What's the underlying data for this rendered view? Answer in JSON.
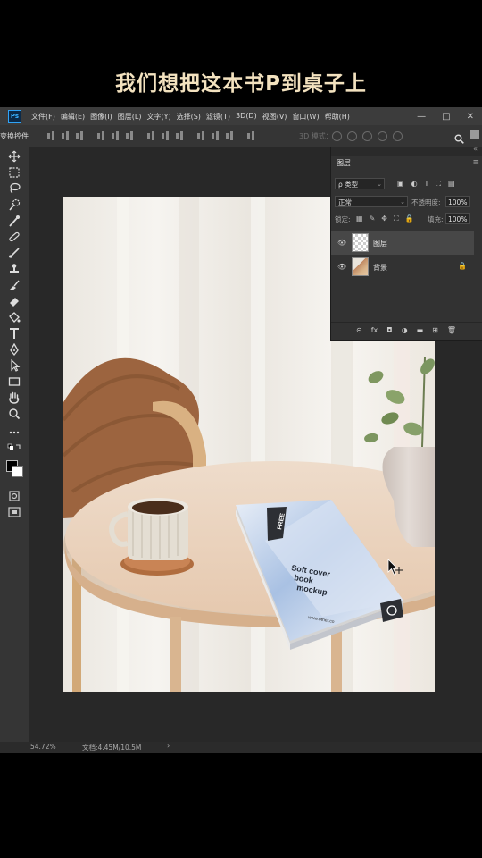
{
  "caption": "我们想把这本书P到桌子上",
  "app": {
    "logo": "Ps",
    "menus": [
      "文件(F)",
      "编辑(E)",
      "图像(I)",
      "图层(L)",
      "文字(Y)",
      "选择(S)",
      "滤镜(T)",
      "3D(D)",
      "视图(V)",
      "窗口(W)",
      "帮助(H)"
    ],
    "window_controls": {
      "minimize": "—",
      "restore": "□",
      "close": "✕"
    }
  },
  "options_bar": {
    "label": "变换控件",
    "mode_3d_label": "3D 模式：",
    "search_icon": "search-icon",
    "workspace_icon": "workspace-icon"
  },
  "layers_panel": {
    "tab": "图层",
    "collapse": "«",
    "menu_icon": "≡",
    "filter_kind": "ρ 类型",
    "filter_icons": [
      "▣",
      "◐",
      "T",
      "⛶",
      "▤"
    ],
    "blend_mode": "正常",
    "opacity_label": "不透明度:",
    "opacity_value": "100%",
    "lock_label": "锁定:",
    "lock_icons": [
      "▦",
      "✎",
      "✥",
      "⛶",
      "🔒"
    ],
    "fill_label": "填充:",
    "fill_value": "100%",
    "dropdown_arrow": "⌄",
    "eye_icon": "👁",
    "lock_icon": "🔒",
    "layers": [
      {
        "name": "图层",
        "thumbnail": "transparent",
        "selected": true,
        "locked": false
      },
      {
        "name": "背景",
        "thumbnail": "photo",
        "selected": false,
        "locked": true
      }
    ],
    "footer_icons": [
      "⊝",
      "fx",
      "◘",
      "◑",
      "▬",
      "⊞",
      "🗑"
    ]
  },
  "canvas": {
    "book": {
      "badge": "FREE",
      "title_lines": [
        "Soft cover",
        "book",
        "mockup"
      ],
      "url": "www.other.co"
    }
  },
  "status_bar": {
    "zoom": "54.72%",
    "doc_size": "文档:4.45M/10.5M",
    "arrow": "›"
  },
  "colors": {
    "caption": "#f3e2bf",
    "app_bg": "#282828",
    "panel_bg": "#323232",
    "accent_ps": "#31a8ff"
  }
}
